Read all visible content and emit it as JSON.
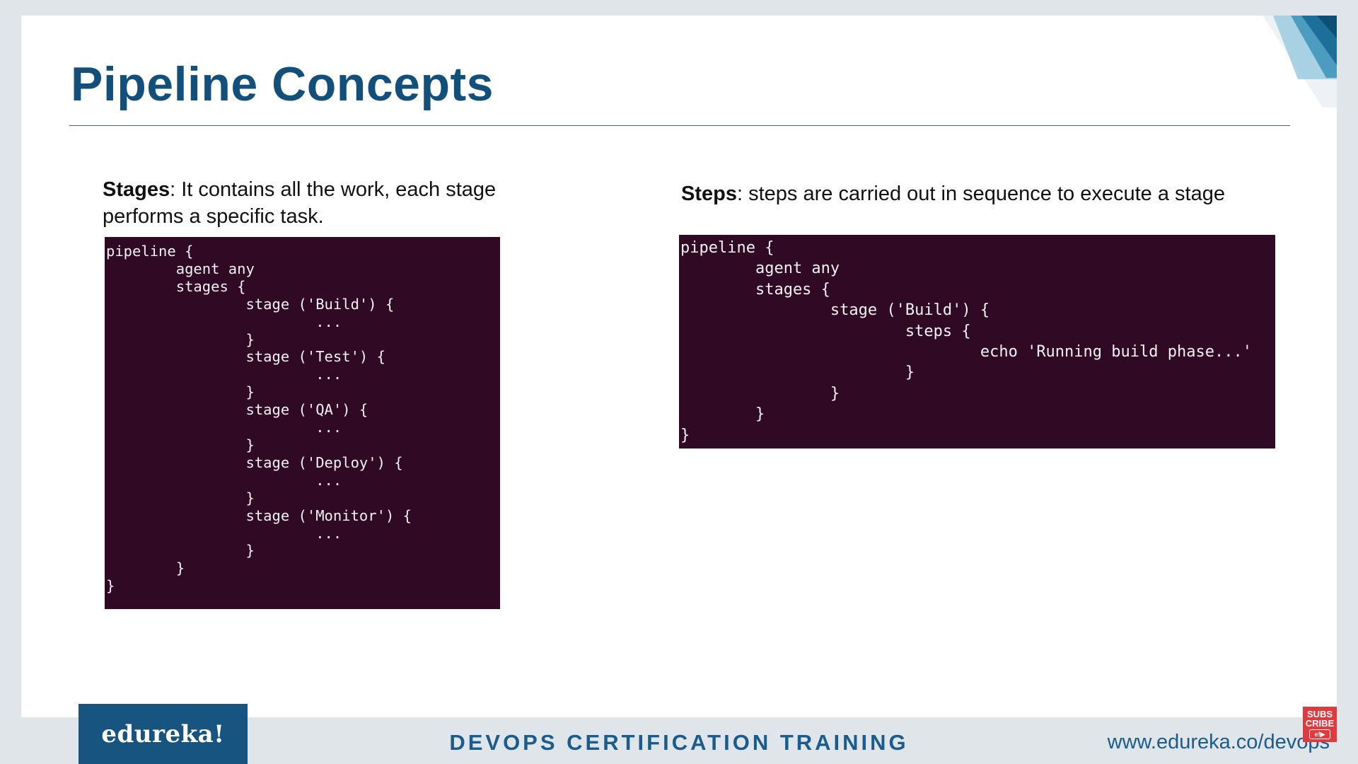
{
  "slide": {
    "title": "Pipeline Concepts"
  },
  "stages_panel": {
    "term": "Stages",
    "description": ": It contains all the work, each stage performs a specific task.",
    "code": "pipeline {\n        agent any\n        stages {\n                stage ('Build') {\n                        ...\n                }\n                stage ('Test') {\n                        ...\n                }\n                stage ('QA') {\n                        ...\n                }\n                stage ('Deploy') {\n                        ...\n                }\n                stage ('Monitor') {\n                        ...\n                }\n        }\n}"
  },
  "steps_panel": {
    "term": "Steps",
    "description": ": steps are carried out in sequence to execute a stage",
    "code": "pipeline {\n        agent any\n        stages {\n                stage ('Build') {\n                        steps {\n                                echo 'Running build phase...'\n                        }\n                }\n        }\n}"
  },
  "footer": {
    "brand": "edureka!",
    "course": "DEVOPS CERTIFICATION TRAINING",
    "url": "www.edureka.co/devops",
    "subscribe_line1": "SUBS",
    "subscribe_line2": "CRIBE",
    "subscribe_icon_text": "e!▶"
  },
  "colors": {
    "title": "#12507b",
    "terminal_bg": "#300a24",
    "footer_accent": "#1a5c8e",
    "logo_bg": "#17547f",
    "subscribe_bg": "#e03a3e"
  }
}
